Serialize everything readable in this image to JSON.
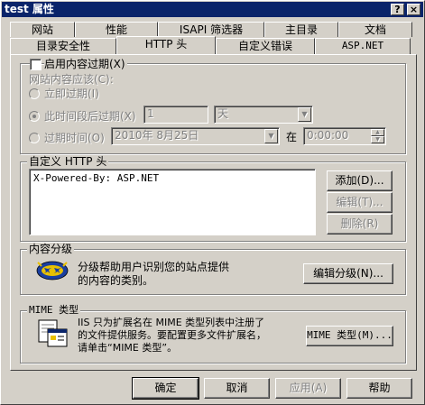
{
  "window": {
    "title": "test 属性",
    "help_btn": "?",
    "close_btn": "×"
  },
  "tabs_row1": [
    "网站",
    "性能",
    "ISAPI 筛选器",
    "主目录",
    "文档"
  ],
  "tabs_row2": [
    "目录安全性",
    "HTTP 头",
    "自定义错误",
    "ASP.NET"
  ],
  "active_tab": "HTTP 头",
  "expiration": {
    "enable_label": "启用内容过期(X)",
    "enabled": false,
    "section_label": "网站内容应该(C):",
    "expire_immediately": "立即过期(I)",
    "expire_after": "此时间段后过期(X)",
    "expire_after_value": "1",
    "expire_after_unit": "天",
    "expire_on": "过期时间(O)",
    "expire_on_date": "2010年  8月25日",
    "at_label": "在",
    "expire_on_time": "0:00:00",
    "selected_option": "此时间段后过期(X)"
  },
  "custom_headers": {
    "label": "自定义 HTTP 头",
    "items": [
      "X-Powered-By: ASP.NET"
    ],
    "add": "添加(D)...",
    "edit": "编辑(T)...",
    "delete": "删除(R)"
  },
  "content_rating": {
    "label": "内容分级",
    "description": "分级帮助用户识别您的站点提供的内容的类别。",
    "edit": "编辑分级(N)..."
  },
  "mime": {
    "label": "MIME 类型",
    "description": "IIS 只为扩展名在 MIME 类型列表中注册了的文件提供服务。要配置更多文件扩展名，请单击“MIME 类型”。",
    "button": "MIME 类型(M)..."
  },
  "footer": {
    "ok": "确定",
    "cancel": "取消",
    "apply": "应用(A)",
    "help": "帮助"
  },
  "icons": {
    "rating": "rating-stars-icon",
    "mime": "document-window-icon"
  }
}
